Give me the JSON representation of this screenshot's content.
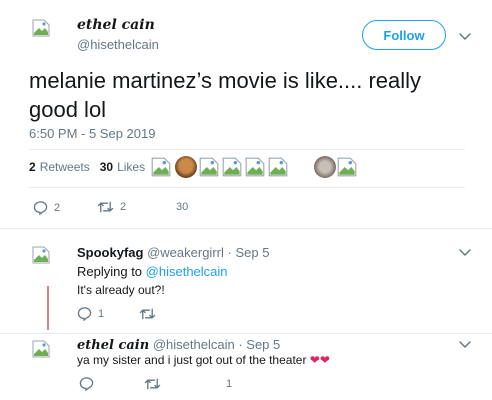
{
  "tweet": {
    "author_name": "ethel cain",
    "author_handle": "@hisethelcain",
    "follow_label": "Follow",
    "text_line1": "melanie martinez’s movie is like.... really",
    "text_line2": "good lol",
    "timestamp": "6:50 PM - 5 Sep 2019",
    "retweets_count": "2",
    "retweets_label": "Retweets",
    "likes_count": "30",
    "likes_label": "Likes",
    "actions": {
      "replies": "2",
      "retweets": "2",
      "likes": "30"
    }
  },
  "replies": [
    {
      "author_name": "Spookyfag",
      "author_handle": "@weakergirrl",
      "sep": "·",
      "date": "Sep 5",
      "replying_prefix": "Replying to",
      "replying_handle": "@hisethelcain",
      "text": "It's already out?!",
      "actions": {
        "replies": "1",
        "retweets": "",
        "likes": ""
      }
    },
    {
      "author_name": "ethel cain",
      "author_handle": "@hisethelcain",
      "sep": "·",
      "date": "Sep 5",
      "text": "ya my sister and i just got out of the theater",
      "emoji": "❤❤",
      "actions": {
        "replies": "",
        "retweets": "",
        "likes": "1"
      }
    }
  ],
  "colors": {
    "accent": "#1da1f2",
    "muted": "#657786",
    "heart": "#e0245e"
  }
}
